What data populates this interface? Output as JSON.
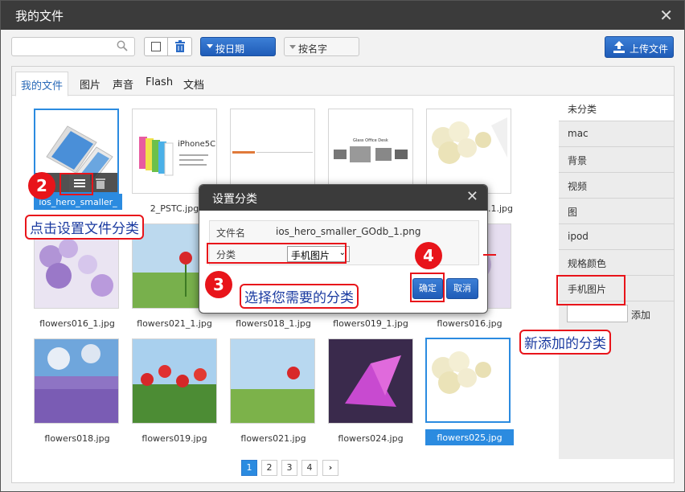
{
  "window": {
    "title": "我的文件"
  },
  "toolbar": {
    "search_placeholder": "",
    "sort_date_label": "按日期",
    "sort_name_label": "按名字",
    "upload_label": "上传文件"
  },
  "tabs": [
    {
      "label": "我的文件"
    },
    {
      "label": "图片"
    },
    {
      "label": "声音"
    },
    {
      "label": "Flash"
    },
    {
      "label": "文档"
    }
  ],
  "files": [
    {
      "name": "ios_hero_smaller_",
      "selected": true
    },
    {
      "name": "2_PSTC.jpg"
    },
    {
      "name": ""
    },
    {
      "name": ""
    },
    {
      "name": "...1.jpg"
    },
    {
      "name": "flowers016_1.jpg"
    },
    {
      "name": "flowers021_1.jpg"
    },
    {
      "name": "flowers018_1.jpg"
    },
    {
      "name": "flowers019_1.jpg"
    },
    {
      "name": "flowers016.jpg"
    },
    {
      "name": "flowers018.jpg"
    },
    {
      "name": "flowers019.jpg"
    },
    {
      "name": "flowers021.jpg"
    },
    {
      "name": "flowers024.jpg"
    },
    {
      "name": "flowers025.jpg",
      "selected": true
    }
  ],
  "thumb_text": {
    "iphone5c": "iPhone5C",
    "glass_office": "Glass Office Desk"
  },
  "categories": [
    {
      "label": "未分类"
    },
    {
      "label": "mac"
    },
    {
      "label": "背景"
    },
    {
      "label": "视频"
    },
    {
      "label": "图"
    },
    {
      "label": "ipod"
    },
    {
      "label": "规格颜色"
    },
    {
      "label": "手机图片"
    }
  ],
  "add_category": {
    "button_label": "添加",
    "value": ""
  },
  "pagination": {
    "pages": [
      "1",
      "2",
      "3",
      "4"
    ],
    "current": "1",
    "next": "›"
  },
  "dialog": {
    "title": "设置分类",
    "filename_label": "文件名",
    "filename_value": "ios_hero_smaller_GOdb_1.png",
    "category_label": "分类",
    "category_value": "手机图片",
    "ok_label": "确定",
    "cancel_label": "取消"
  },
  "annotations": {
    "step2_num": "2",
    "step2_text": "点击设置文件分类",
    "step3_num": "3",
    "step3_text": "选择您需要的分类",
    "step4_num": "4",
    "new_cat_text": "新添加的分类"
  },
  "colors": {
    "accent": "#2b8be0",
    "button_blue": "#2a6bc6",
    "annotation_red": "#e8141a",
    "titlebar": "#3b3b3b"
  }
}
